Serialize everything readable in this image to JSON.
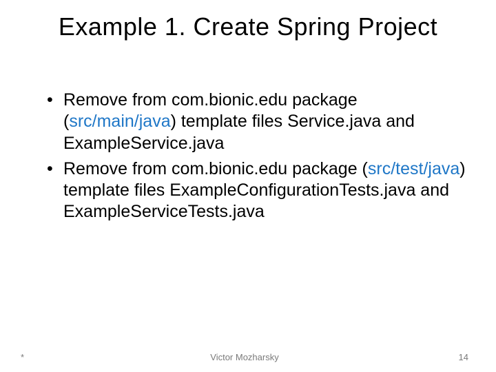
{
  "title": "Example 1. Create Spring Project",
  "bullets": [
    {
      "pre": "Remove from com.bionic.edu package (",
      "highlight": "src/main/java",
      "post": ") template files Service.java and ExampleService.java"
    },
    {
      "pre": "Remove from com.bionic.edu package (",
      "highlight": "src/test/java",
      "post": ") template files ExampleConfigurationTests.java and ExampleServiceTests.java"
    }
  ],
  "footer": {
    "left": "*",
    "center": "Victor Mozharsky",
    "right": "14"
  }
}
